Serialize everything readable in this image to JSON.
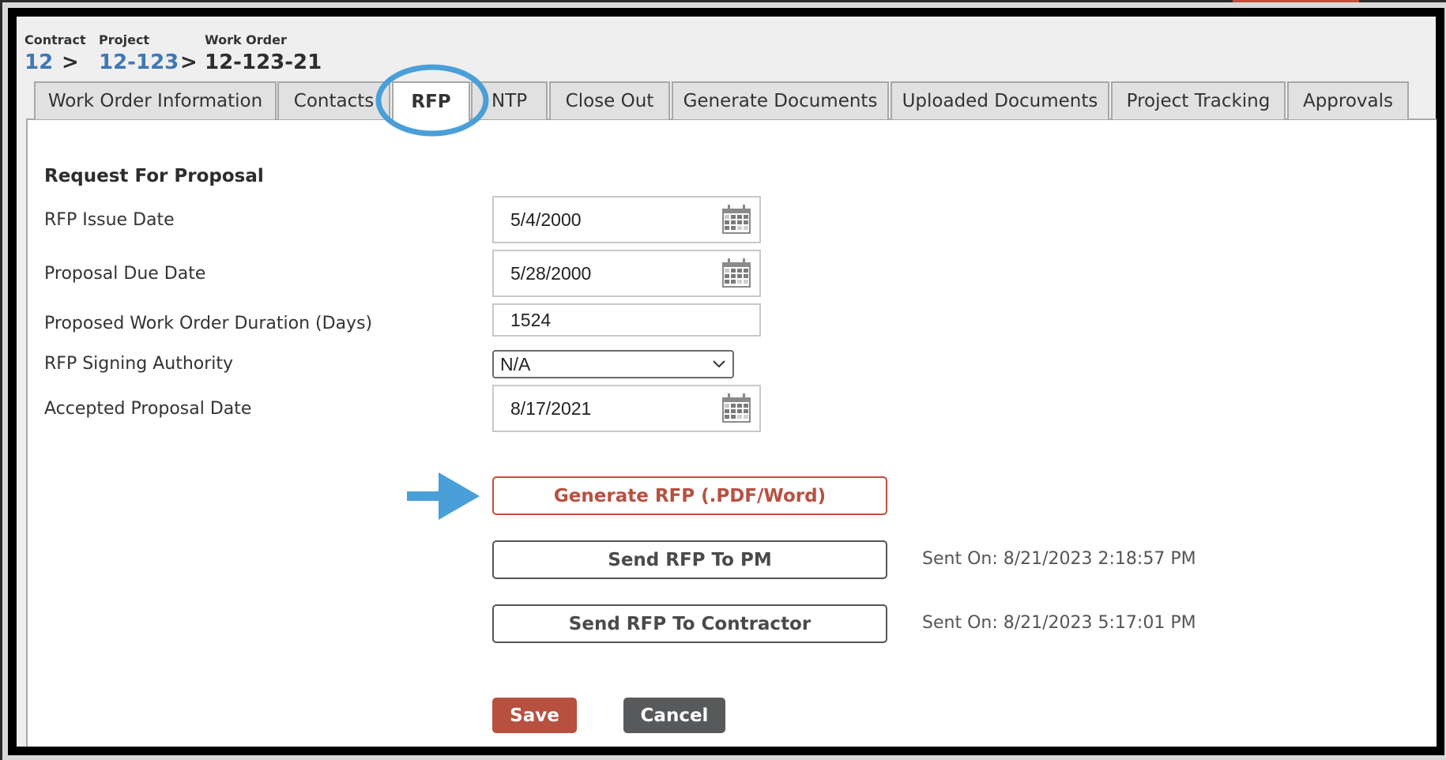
{
  "breadcrumb": {
    "contract_label": "Contract",
    "contract_value": "12",
    "project_label": "Project",
    "project_value": "12-123",
    "work_order_label": "Work Order",
    "work_order_value": "12-123-21",
    "separator": ">"
  },
  "tabs": [
    {
      "label": "Work Order Information",
      "active": false
    },
    {
      "label": "Contacts",
      "active": false
    },
    {
      "label": "RFP",
      "active": true
    },
    {
      "label": "NTP",
      "active": false
    },
    {
      "label": "Close Out",
      "active": false
    },
    {
      "label": "Generate Documents",
      "active": false
    },
    {
      "label": "Uploaded Documents",
      "active": false
    },
    {
      "label": "Project Tracking",
      "active": false
    },
    {
      "label": "Approvals",
      "active": false
    }
  ],
  "form": {
    "heading": "Request For Proposal",
    "rfp_issue_date": {
      "label": "RFP Issue Date",
      "value": "5/4/2000"
    },
    "proposal_due_date": {
      "label": "Proposal Due Date",
      "value": "5/28/2000"
    },
    "duration": {
      "label": "Proposed Work Order Duration (Days)",
      "value": "1524"
    },
    "signing_authority": {
      "label": "RFP Signing Authority",
      "value": "N/A"
    },
    "accepted_proposal_date": {
      "label": "Accepted Proposal Date",
      "value": "8/17/2021"
    }
  },
  "actions": {
    "generate_rfp": "Generate RFP (.PDF/Word)",
    "send_to_pm": "Send RFP To PM",
    "send_to_pm_status": "Sent On: 8/21/2023 2:18:57 PM",
    "send_to_contractor": "Send RFP To Contractor",
    "send_to_contractor_status": "Sent On: 8/21/2023 5:17:01 PM",
    "save": "Save",
    "cancel": "Cancel"
  },
  "annotations": {
    "highlight_color": "#4a9fd8",
    "highlighted_tab": "RFP",
    "arrow_target": "Generate RFP (.PDF/Word)"
  },
  "colors": {
    "link": "#3f78b5",
    "primary": "#b85040",
    "secondary": "#58595b"
  }
}
